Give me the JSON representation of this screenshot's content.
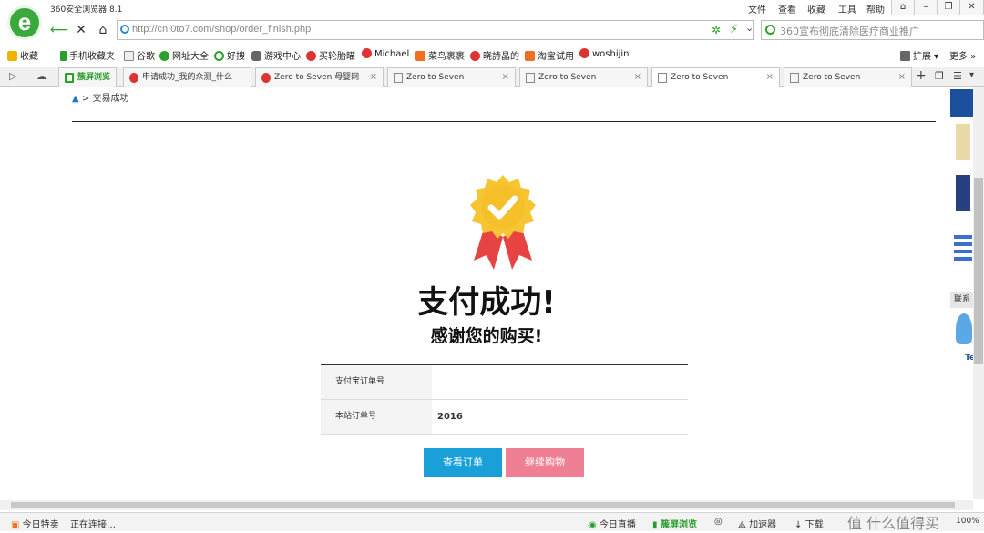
{
  "window": {
    "app_name": "360安全浏览器 8.1",
    "menu": [
      "文件",
      "查看",
      "收藏",
      "工具",
      "帮助"
    ]
  },
  "nav": {
    "url": "http://cn.0to7.com/shop/order_finish.php",
    "search_text": "360宣布彻底清除医疗商业推广"
  },
  "bookmarks": [
    {
      "label": "收藏",
      "color": "#f0b400"
    },
    {
      "label": "手机收藏夹",
      "color": "#2aa02a"
    },
    {
      "label": "谷歌",
      "color": "#888888"
    },
    {
      "label": "网址大全",
      "color": "#2aa02a"
    },
    {
      "label": "好搜",
      "color": "#2aa02a"
    },
    {
      "label": "游戏中心",
      "color": "#666666"
    },
    {
      "label": "买轮胎瞄",
      "color": "#d33"
    },
    {
      "label": "Michael",
      "color": "#d33"
    },
    {
      "label": "菜鸟裹裹",
      "color": "#f07020"
    },
    {
      "label": "晓詩晶的",
      "color": "#d33"
    },
    {
      "label": "淘宝试用",
      "color": "#f07020"
    },
    {
      "label": "woshijin",
      "color": "#d33"
    },
    {
      "label": "扩展",
      "color": "#666666"
    },
    {
      "label": "更多",
      "color": "#666666"
    }
  ],
  "tabs": [
    {
      "label": "申请成功_我的众测_什么",
      "active": false
    },
    {
      "label": "Zero to Seven 母婴网",
      "active": false
    },
    {
      "label": "Zero to Seven",
      "active": false
    },
    {
      "label": "Zero to Seven",
      "active": false
    },
    {
      "label": "Zero to Seven",
      "active": true
    },
    {
      "label": "Zero to Seven",
      "active": false
    }
  ],
  "tabs_extra": {
    "split_label": "簇屏浏览"
  },
  "page": {
    "breadcrumb": "交易成功",
    "title": "支付成功!",
    "subtitle": "感谢您的购买!",
    "rows": [
      {
        "label": "支付宝订单号",
        "value": ""
      },
      {
        "label": "本站订单号",
        "value": "2016"
      }
    ],
    "view_order_label": "查看订单",
    "continue_label": "继续购物",
    "colors": {
      "view_button": "#1aa0d8",
      "continue_button": "#ef7f93",
      "badge": "#f7c531",
      "ribbon": "#e84343"
    }
  },
  "side_ad": {
    "label": "联系",
    "brand": "Te"
  },
  "status": {
    "left1": "今日特卖",
    "left2": "正在连接…",
    "live": "今日直播",
    "split": "簇屏浏览",
    "accel": "加速器",
    "download": "下载",
    "zoom": "100%",
    "watermark": "值 什么值得买"
  }
}
